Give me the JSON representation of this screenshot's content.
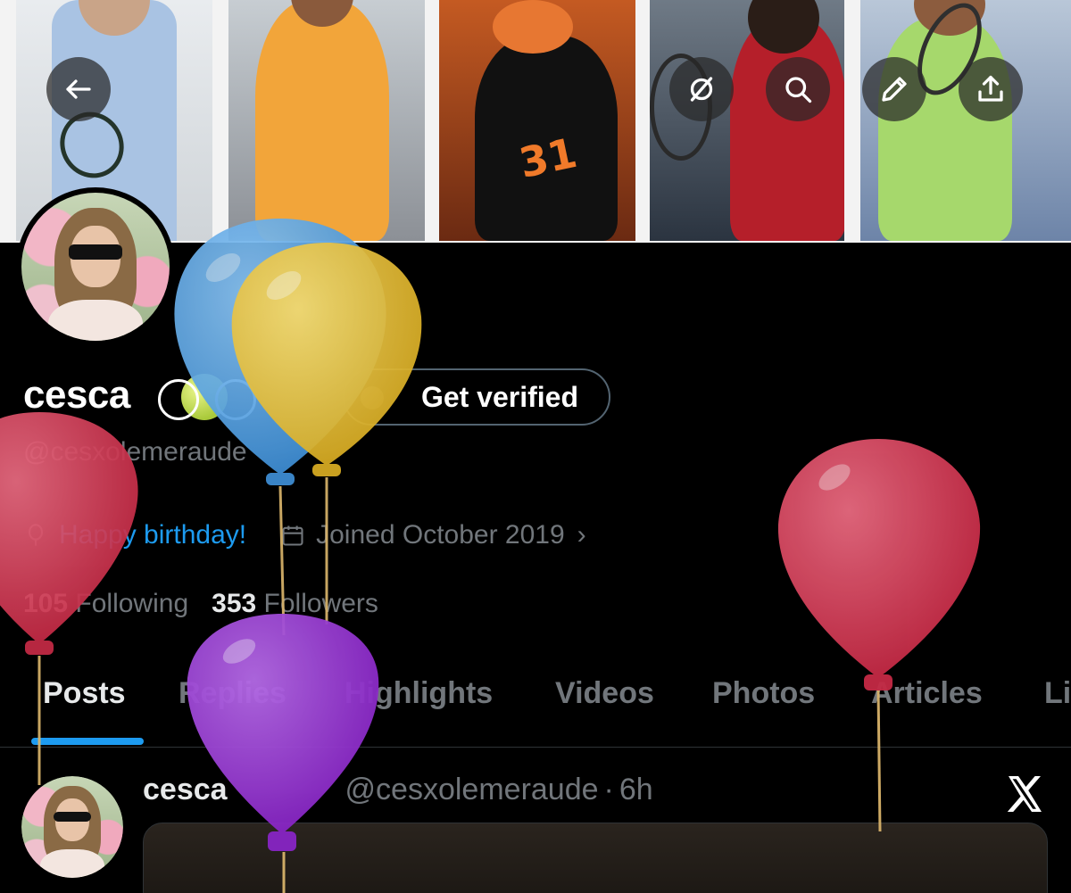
{
  "header": {
    "back_icon": "arrow-left-icon",
    "actions": [
      "grok-icon",
      "search-icon",
      "edit-icon",
      "share-icon"
    ]
  },
  "profile": {
    "name": "cesca",
    "name_emoji": "tennis-ball",
    "handle": "@cesxolemeraude",
    "verify_label": "Get verified",
    "birthday": "Happy birthday!",
    "joined": "Joined October 2019",
    "following_count": "105",
    "following_label": "Following",
    "followers_count": "353",
    "followers_label": "Followers"
  },
  "tabs": [
    "Posts",
    "Replies",
    "Highlights",
    "Videos",
    "Photos",
    "Articles",
    "Li"
  ],
  "active_tab": "Posts",
  "post": {
    "name": "cesca",
    "handle": "@cesxolemeraude",
    "separator": "·",
    "time": "6h"
  },
  "colors": {
    "accent": "#1d9bf0",
    "muted": "#71767b",
    "background": "#000000",
    "balloon_blue": "#5aa6e6",
    "balloon_yellow": "#ebc33b",
    "balloon_red": "#d33a56",
    "balloon_purple": "#9b38d6"
  }
}
